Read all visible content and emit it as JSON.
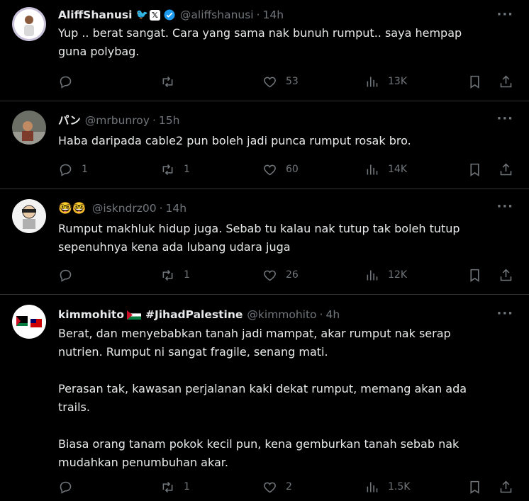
{
  "tweets": [
    {
      "name": "AliffShanusi",
      "handle": "@aliffshanusi",
      "time": "14h",
      "text": [
        "Yup .. berat sangat. Cara yang sama nak bunuh rumput.. saya hempap guna polybag."
      ],
      "replies": "",
      "retweets": "",
      "likes": "53",
      "views": "13K",
      "name_icons": [
        "bird-emoji",
        "x-logo-badge",
        "verified-badge"
      ]
    },
    {
      "name": "パン",
      "handle": "@mrbunroy",
      "time": "15h",
      "text": [
        "Haba daripada cable2 pun boleh jadi punca rumput rosak bro."
      ],
      "replies": "1",
      "retweets": "1",
      "likes": "60",
      "views": "14K"
    },
    {
      "name": "🤓🤓",
      "handle": "@iskndrz00",
      "time": "14h",
      "text": [
        "Rumput makhluk hidup juga. Sebab tu kalau nak tutup tak boleh tutup sepenuhnya kena ada lubang udara juga"
      ],
      "replies": "",
      "retweets": "1",
      "likes": "26",
      "views": "12K"
    },
    {
      "name": "kimmohito",
      "name_suffix": "#JihadPalestine",
      "handle": "@kimmohito",
      "time": "4h",
      "text": [
        "Berat, dan menyebabkan tanah jadi mampat, akar rumput nak serap nutrien. Rumput ni sangat fragile, senang mati.",
        "Perasan tak, kawasan perjalanan kaki dekat rumput, memang akan ada trails.",
        "Biasa orang tanam pokok kecil pun, kena gemburkan tanah sebab nak mudahkan penumbuhan akar."
      ],
      "replies": "",
      "retweets": "1",
      "likes": "2",
      "views": "1.5K",
      "name_icons": [
        "palestine-flag"
      ]
    }
  ],
  "separator": "·",
  "colors": {
    "background": "#000000",
    "text": "#e7e9ea",
    "muted": "#71767b",
    "border": "#2f3336",
    "verified": "#1d9bf0"
  }
}
